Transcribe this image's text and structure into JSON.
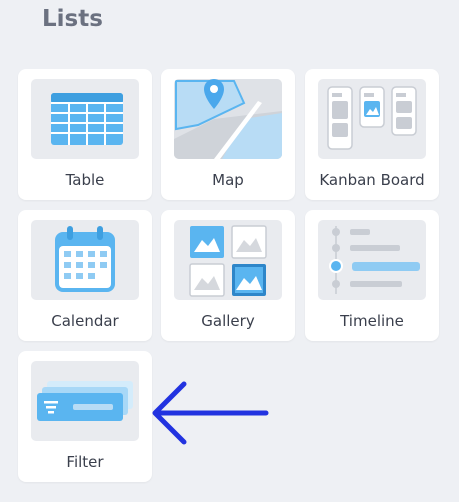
{
  "page": {
    "title": "Lists"
  },
  "cards": {
    "table": "Table",
    "map": "Map",
    "kanban": "Kanban Board",
    "calendar": "Calendar",
    "gallery": "Gallery",
    "timeline": "Timeline",
    "filter": "Filter"
  },
  "colors": {
    "accent": "#5ab5f0",
    "arrow": "#2233e0",
    "background": "#eef0f4"
  },
  "icons": [
    "table-icon",
    "map-icon",
    "kanban-icon",
    "calendar-icon",
    "gallery-icon",
    "timeline-icon",
    "filter-icon",
    "arrow-left-icon"
  ]
}
